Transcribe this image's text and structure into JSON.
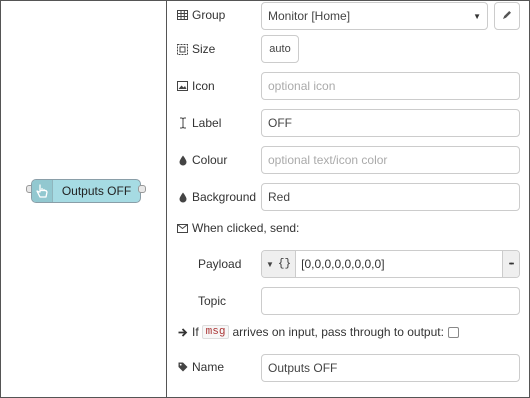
{
  "node": {
    "label": "Outputs OFF",
    "icon": "hand-pointer-icon"
  },
  "form": {
    "group": {
      "label": "Group",
      "value": "Monitor [Home]",
      "edit_icon": "pencil-icon"
    },
    "size": {
      "label": "Size",
      "value": "auto"
    },
    "icon": {
      "label": "Icon",
      "placeholder": "optional icon"
    },
    "label": {
      "label": "Label",
      "value": "OFF"
    },
    "colour": {
      "label": "Colour",
      "placeholder": "optional text/icon color"
    },
    "background": {
      "label": "Background",
      "value": "Red"
    },
    "when_clicked": {
      "label": "When clicked, send:"
    },
    "payload": {
      "label": "Payload",
      "type_symbol": "{}",
      "value": "[0,0,0,0,0,0,0,0]",
      "expand_label": "•••"
    },
    "topic": {
      "label": "Topic",
      "value": ""
    },
    "passthrough": {
      "prefix": "If",
      "code": "msg",
      "suffix": "arrives on input, pass through to output:",
      "checked": false
    },
    "name": {
      "label": "Name",
      "value": "Outputs OFF"
    }
  },
  "colors": {
    "node_fill": "#a6dbe3",
    "node_border": "#8a9ea8",
    "code_text": "#a33333"
  }
}
